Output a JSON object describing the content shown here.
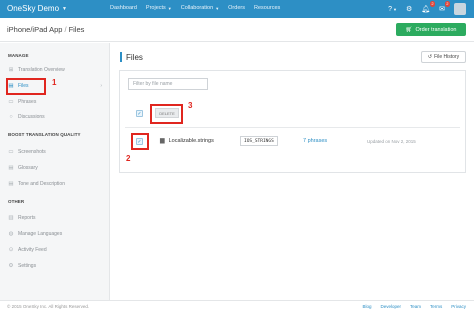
{
  "navbar": {
    "brand": "OneSky Demo",
    "items": [
      "Dashboard",
      "Projects",
      "Collaboration",
      "Orders",
      "Resources"
    ],
    "notifications_count": "2",
    "messages_count": "2"
  },
  "project": {
    "breadcrumb_project": "iPhone/iPad App",
    "breadcrumb_sep": "/",
    "breadcrumb_page": "Files",
    "order_button": "Order translation"
  },
  "sidebar": {
    "manage_title": "MANAGE",
    "manage_items": [
      "Translation Overview",
      "Files",
      "Phrases",
      "Discussions"
    ],
    "boost_title": "BOOST TRANSLATION QUALITY",
    "boost_items": [
      "Screenshots",
      "Glossary",
      "Tone and Description"
    ],
    "other_title": "OTHER",
    "other_items": [
      "Reports",
      "Manage Languages",
      "Activity Feed",
      "Settings"
    ]
  },
  "main": {
    "title": "Files",
    "history_button": "File History",
    "filter_placeholder": "Filter by file name",
    "delete_button": "DELETE",
    "file": {
      "name": "Localizable.strings",
      "format": "IOS_STRINGS",
      "phrases": "7 phrases",
      "updated": "Updated on Nov 2, 2015"
    }
  },
  "annotations": [
    "1",
    "2",
    "3"
  ],
  "footer": {
    "copyright": "© 2015 OneSky Inc. All Rights Reserved.",
    "links": [
      "Blog",
      "Developer",
      "Team",
      "Terms",
      "Privacy"
    ]
  },
  "colors": {
    "navbar": "#2d8fc5",
    "order_button": "#2cab5f",
    "annotation": "#e0261f"
  }
}
